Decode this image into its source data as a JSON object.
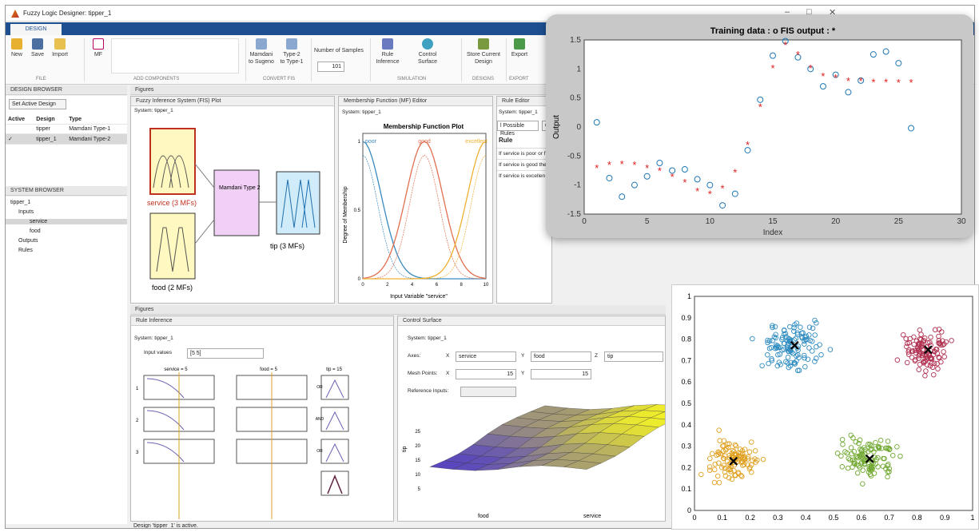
{
  "window": {
    "title": "Fuzzy Logic Designer: tipper_1",
    "controls": [
      "–",
      "□",
      "✕"
    ]
  },
  "ribbon": {
    "tab": "DESIGN",
    "file": {
      "new": "New",
      "save": "Save",
      "import": "Import",
      "group": "FILE"
    },
    "mf": "MF",
    "add_group": "ADD COMPONENTS",
    "convert": {
      "to_sugeno": "Mamdani\nto Sugeno",
      "to_type1": "Type-2\nto Type-1",
      "group": "CONVERT FIS"
    },
    "samples": {
      "label": "Number of Samples",
      "value": "101"
    },
    "simulation": {
      "rule_inference": "Rule\nInference",
      "control_surface": "Control\nSurface",
      "group": "SIMULATION"
    },
    "designs": {
      "store": "Store Current\nDesign",
      "group": "DESIGNS"
    },
    "export": {
      "label": "Export",
      "group": "EXPORT"
    }
  },
  "design_browser": {
    "title": "DESIGN BROWSER",
    "set_active": "Set Active Design",
    "headers": [
      "Active",
      "Design",
      "Type"
    ],
    "rows": [
      {
        "active": "",
        "design": "tipper",
        "type": "Mamdani Type-1"
      },
      {
        "active": "✓",
        "design": "tipper_1",
        "type": "Mamdani Type-2"
      }
    ]
  },
  "system_browser": {
    "title": "SYSTEM BROWSER",
    "items": [
      "tipper_1",
      "Inputs",
      "service",
      "food",
      "Outputs",
      "Rules"
    ]
  },
  "figures": {
    "title": "Figures",
    "fis_tab": "Fuzzy Inference System (FIS) Plot",
    "mf_tab": "Membership Function (MF) Editor",
    "rule_tab": "Rule Editor",
    "system": "System: tipper_1",
    "fis": {
      "service": "service (3 MFs)",
      "food": "food (2 MFs)",
      "mamdani": "Mamdani\nType 2",
      "tip": "tip (3 MFs)"
    },
    "mf_plot": {
      "title": "Membership Function Plot",
      "xlabel": "Input Variable \"service\"",
      "ylabel": "Degree of Membership",
      "labels": [
        "poor",
        "good",
        "excellent"
      ],
      "xticks": [
        "0",
        "2",
        "4",
        "6",
        "8",
        "10"
      ],
      "yticks": [
        "0",
        "0.5",
        "1"
      ]
    },
    "rule_editor": {
      "button1": "l Possible Rules",
      "button2": "C",
      "col": "Rule",
      "rules": [
        "If service is poor or f",
        "If service is good the",
        "If service is excellen"
      ]
    }
  },
  "bottom_figures": {
    "title": "Figures",
    "rule_inf_tab": "Rule Inference",
    "ctrl_tab": "Control Surface",
    "system": "System: tipper_1",
    "input_label": "Input values",
    "input_value": "[5 5]",
    "col_titles": [
      "service = 5",
      "food = 5",
      "tip = 15"
    ],
    "ops": [
      "OR\n(max)",
      "AND\n(min)",
      "OR\n(max)"
    ],
    "row_nums": [
      "1",
      "2",
      "3"
    ],
    "axes_label": "Axes:",
    "x": "X",
    "y": "Y",
    "z": "Z",
    "x_var": "service",
    "y_var": "food",
    "z_var": "tip",
    "mesh_label": "Mesh Points:",
    "mesh_x": "15",
    "mesh_y": "15",
    "ref_label": "Reference Inputs:",
    "surface_zlabel": "tip",
    "surface_xlabel": "food",
    "surface_ylabel": "service",
    "z_ticks": [
      "5",
      "10",
      "15",
      "20",
      "25"
    ],
    "food_ticks": [
      "0",
      "5",
      "10"
    ],
    "service_ticks": [
      "0",
      "2",
      "4",
      "6",
      "8",
      "10"
    ]
  },
  "status": "Design 'tipper_1' is active.",
  "chart_data": [
    {
      "type": "scatter",
      "title": "Training data : o    FIS output : *",
      "xlabel": "Index",
      "ylabel": "Output",
      "xlim": [
        0,
        30
      ],
      "ylim": [
        -1.5,
        1.5
      ],
      "xticks": [
        0,
        5,
        10,
        15,
        20,
        25,
        30
      ],
      "yticks": [
        -1.5,
        -1,
        -0.5,
        0,
        0.5,
        1,
        1.5
      ],
      "series": [
        {
          "marker": "o",
          "color": "#1f77b4",
          "x": [
            1,
            2,
            3,
            4,
            5,
            6,
            7,
            8,
            9,
            10,
            11,
            12,
            13,
            14,
            15,
            16,
            17,
            18,
            19,
            20,
            21,
            22,
            23,
            24,
            25,
            26
          ],
          "y": [
            0.08,
            -0.88,
            -1.2,
            -1.0,
            -0.85,
            -0.62,
            -0.75,
            -0.73,
            -0.9,
            -1.0,
            -1.35,
            -1.15,
            -0.4,
            0.47,
            1.23,
            1.48,
            1.2,
            1.0,
            0.7,
            0.9,
            0.6,
            0.8,
            1.25,
            1.3,
            1.1,
            -0.02
          ]
        },
        {
          "marker": "*",
          "color": "#e02020",
          "x": [
            1,
            2,
            3,
            4,
            5,
            6,
            7,
            8,
            9,
            10,
            11,
            12,
            13,
            14,
            15,
            16,
            17,
            18,
            19,
            20,
            21,
            22,
            23,
            24,
            25,
            26
          ],
          "y": [
            -0.7,
            -0.65,
            -0.63,
            -0.65,
            -0.7,
            -0.75,
            -0.85,
            -0.95,
            -1.1,
            -1.15,
            -1.05,
            -0.78,
            -0.3,
            0.35,
            1.02,
            1.42,
            1.25,
            1.02,
            0.88,
            0.85,
            0.8,
            0.8,
            0.78,
            0.78,
            0.77,
            0.77
          ]
        }
      ]
    },
    {
      "type": "scatter",
      "xlim": [
        0,
        1
      ],
      "ylim": [
        0,
        1
      ],
      "xticks": [
        0,
        0.1,
        0.2,
        0.3,
        0.4,
        0.5,
        0.6,
        0.7,
        0.8,
        0.9,
        1
      ],
      "yticks": [
        0,
        0.1,
        0.2,
        0.3,
        0.4,
        0.5,
        0.6,
        0.7,
        0.8,
        0.9,
        1
      ],
      "clusters": [
        {
          "color": "#2f8cc0",
          "center": [
            0.36,
            0.77
          ],
          "spread": 0.09,
          "count": 120
        },
        {
          "color": "#b03050",
          "center": [
            0.84,
            0.75
          ],
          "spread": 0.07,
          "count": 110
        },
        {
          "color": "#e0a020",
          "center": [
            0.14,
            0.23
          ],
          "spread": 0.08,
          "count": 110
        },
        {
          "color": "#70a830",
          "center": [
            0.63,
            0.24
          ],
          "spread": 0.08,
          "count": 110
        }
      ]
    }
  ]
}
